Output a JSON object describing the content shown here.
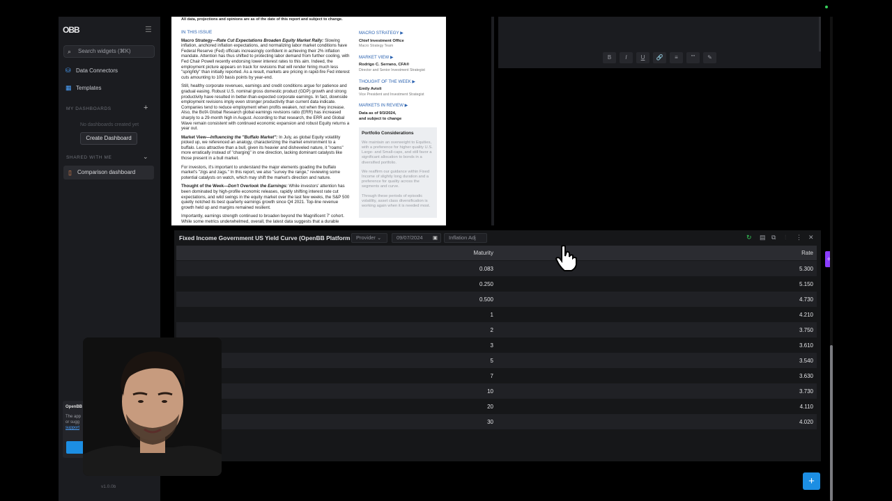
{
  "sidebar": {
    "logo": "OBB",
    "search_placeholder": "Search widgets (⌘K)",
    "nav": [
      {
        "label": "Data Connectors",
        "icon": "data-connectors-icon"
      },
      {
        "label": "Templates",
        "icon": "templates-icon"
      }
    ],
    "my_dashboards": "MY DASHBOARDS",
    "empty": "No dashboards created yet",
    "create_label": "Create Dashboard",
    "shared": "SHARED WITH ME",
    "shared_items": [
      {
        "label": "Comparison dashboard"
      }
    ],
    "notice_title": "OpenBB",
    "notice_text": "The app or sugg",
    "notice_link": "support",
    "version": "v1.0.0b"
  },
  "doc": {
    "disclaimer": "All data, projections and opinions are as of the date of this report and subject to change.",
    "issue_heading": "IN THIS ISSUE",
    "paragraphs": [
      {
        "lead": "Macro Strategy—",
        "title": "Rate Cut Expectations Broaden Equity Market Rally:",
        "text": " Slowing inflation, anchored inflation expectations, and normalizing labor market conditions have Federal Reserve (Fed) officials increasingly confident in achieving their 2% inflation mandate. Attention has thus shifted to protecting labor demand from further cooling, with Fed Chair Powell recently endorsing lower interest rates to this aim. Indeed, the employment picture appears on track for revisions that will render hiring much less \"sprightly\" than initially reported. As a result, markets are pricing in rapid-fire Fed interest cuts amounting to 100 basis points by year-end."
      },
      {
        "lead": "",
        "title": "",
        "text": "Still, healthy corporate revenues, earnings and credit conditions argue for patience and gradual easing. Robust U.S. nominal gross domestic product (GDP) growth and strong productivity have resulted in better-than-expected corporate earnings. In fact, downside employment revisions imply even stronger productivity than current data indicate. Companies tend to reduce employment when profits weaken, not when they increase. Also, the BofA Global Research global earnings revisions ratio (ERR) has increased sharply to a 29-month high in August. According to that research, the ERR and Global Wave remain consistent with continued economic expansion and robust Equity returns a year out."
      },
      {
        "lead": "Market View—",
        "title": "Influencing the \"Buffalo Market\":",
        "text": " In July, as global Equity volatility picked up, we referenced an analogy, characterizing the market environment to a buffalo. Less attractive than a bull, given its heavier and disheveled nature, it \"roams\" more erratically instead of \"charging\" in one direction, lacking dominant catalysts like those present in a bull market."
      },
      {
        "lead": "",
        "title": "",
        "text": "For investors, it's important to understand the major elements goading the buffalo market's \"zigs and zags.\" In this report, we also \"survey the range,\" reviewing some potential catalysts on watch, which may shift the market's direction and nature."
      },
      {
        "lead": "Thought of the Week—",
        "title": "Don't Overlook the Earnings:",
        "text": " While investors' attention has been dominated by high-profile economic releases, rapidly shifting interest rate cut expectations, and wild swings in the equity market over the last few weeks, the S&P 500 quietly notched its best quarterly earnings growth since Q4 2021. Top-line revenue growth held up and margins remained resilient."
      },
      {
        "lead": "",
        "title": "",
        "text": "Importantly, earnings strength continued to broaden beyond the Magnificent 7' cohort. While some metrics underwhelmed, overall, the latest data suggests that a durable"
      }
    ],
    "right": [
      {
        "heading": "MACRO STRATEGY ▶",
        "name": "Chief Investment Office",
        "role": "Macro Strategy Team"
      },
      {
        "heading": "MARKET VIEW ▶",
        "name": "Rodrigo C. Serrano, CFA®",
        "role": "Director and Senior Investment Strategist"
      },
      {
        "heading": "THOUGHT OF THE WEEK ▶",
        "name": "Emily Avioli",
        "role": "Vice President and Investment Strategist"
      },
      {
        "heading": "MARKETS IN REVIEW ▶",
        "name": "",
        "role": ""
      }
    ],
    "asof_1": "Data as of 9/3/2024,",
    "asof_2": "and subject to change",
    "portfolio_title": "Portfolio Considerations",
    "portfolio": [
      "We maintain an overweight to Equities, with a preference for higher quality U.S. Large- and Small-caps, and still favor a significant allocation to bonds in a diversified portfolio.",
      "We reaffirm our guidance within Fixed Income of slightly long duration and a preference for quality across the segments and curve.",
      "Through these periods of episodic volatility, asset class diversification is working again when it is needed most."
    ]
  },
  "editor": {
    "toolbar": [
      "B",
      "I",
      "U",
      "🔗",
      "≡",
      "\"\"",
      "✎"
    ]
  },
  "widget": {
    "title": "Fixed Income Government US Yield Curve (OpenBB Platform API)",
    "provider": "Provider",
    "date": "09/07/2024",
    "inflation": "Inflation Adj",
    "columns": [
      "Maturity",
      "Rate"
    ],
    "rows": [
      [
        "0.083",
        "5.300"
      ],
      [
        "0.250",
        "5.150"
      ],
      [
        "0.500",
        "4.730"
      ],
      [
        "1",
        "4.210"
      ],
      [
        "2",
        "3.750"
      ],
      [
        "3",
        "3.610"
      ],
      [
        "5",
        "3.540"
      ],
      [
        "7",
        "3.630"
      ],
      [
        "10",
        "3.730"
      ],
      [
        "20",
        "4.110"
      ],
      [
        "30",
        "4.020"
      ]
    ]
  },
  "fab_label": "+",
  "colors": {
    "accent": "#1c8ee3",
    "purple": "#8a3dff",
    "green": "#36d15b"
  }
}
